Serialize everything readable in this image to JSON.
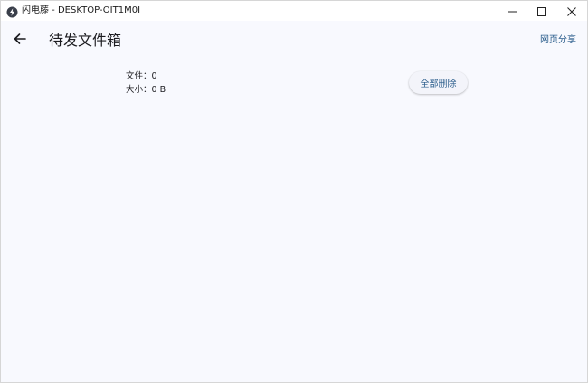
{
  "window": {
    "title": "闪电藤 - DESKTOP-OIT1M0I",
    "controls": {
      "minimize_icon": "minimize-icon",
      "maximize_icon": "maximize-icon",
      "close_icon": "close-icon"
    }
  },
  "appbar": {
    "back_icon": "arrow-left-icon",
    "title": "待发文件箱",
    "share_label": "网页分享"
  },
  "stats": {
    "files_label": "文件：",
    "files_value": "0",
    "size_label": "大小：",
    "size_value": "0 B"
  },
  "actions": {
    "delete_all_label": "全部删除"
  },
  "colors": {
    "background": "#f8f9fe",
    "accent": "#2a5d8c",
    "text": "#1b1b1f"
  }
}
